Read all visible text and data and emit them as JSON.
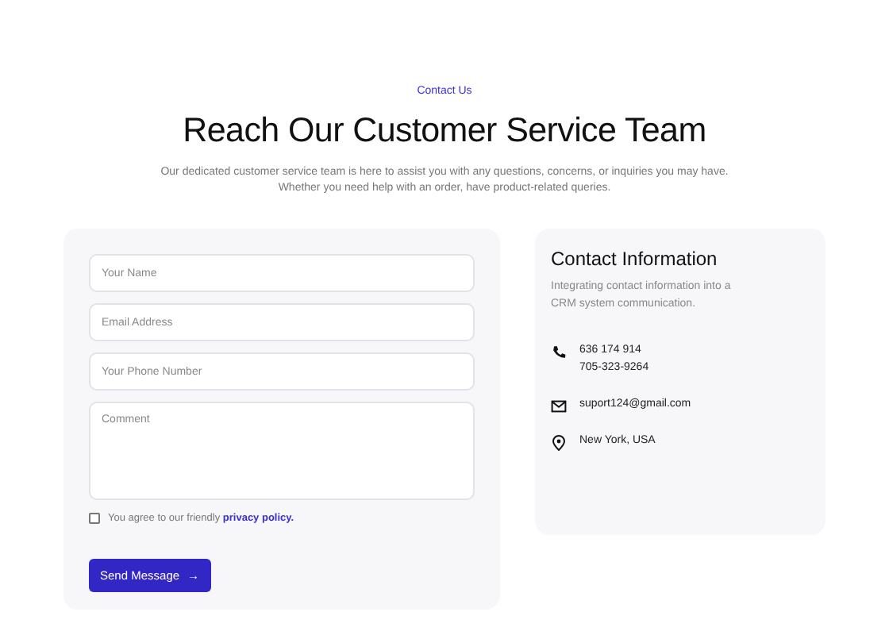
{
  "header": {
    "eyebrow": "Contact Us",
    "title": "Reach Our Customer Service Team",
    "description": "Our dedicated customer service team is here to assist you with any questions, concerns, or inquiries you may have. Whether you need help with an order, have product-related queries."
  },
  "form": {
    "fields": [
      {
        "kind": "input",
        "placeholder": "Your Name"
      },
      {
        "kind": "input",
        "placeholder": "Email Address"
      },
      {
        "kind": "input",
        "placeholder": "Your Phone Number"
      },
      {
        "kind": "textarea",
        "placeholder": "Comment"
      }
    ],
    "agreement": {
      "checked": false,
      "text": "You agree to our friendly",
      "link": "privacy policy."
    },
    "submit": {
      "label": "Send Message",
      "icon": "→"
    }
  },
  "contact_info": {
    "title": "Contact Information",
    "description": "Integrating contact information into a CRM system communication.",
    "items": [
      {
        "kind": "phone",
        "lines": [
          "636 174 914",
          "705-323-9264"
        ]
      },
      {
        "kind": "email",
        "lines": [
          "suport124@gmail.com"
        ]
      },
      {
        "kind": "location",
        "lines": [
          "New York, USA"
        ]
      }
    ]
  }
}
